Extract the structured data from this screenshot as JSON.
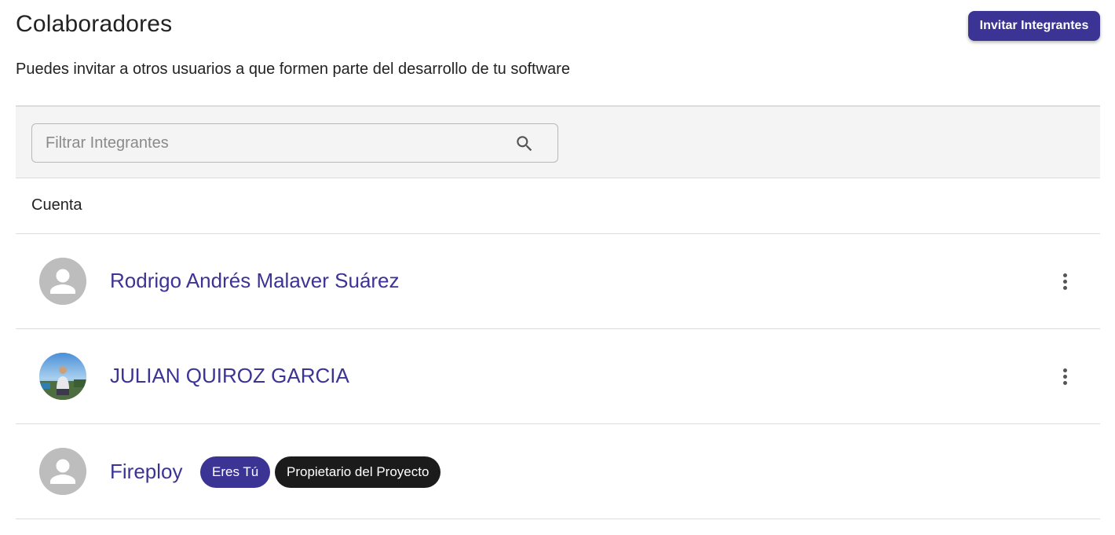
{
  "header": {
    "title": "Colaboradores",
    "invite_label": "Invitar Integrantes",
    "subtitle": "Puedes invitar a otros usuarios a que formen parte del desarrollo de tu software"
  },
  "filter": {
    "placeholder": "Filtrar Integrantes",
    "value": "",
    "icon": "search-icon"
  },
  "table": {
    "column_header": "Cuenta",
    "members": [
      {
        "name": "Rodrigo Andrés Malaver Suárez",
        "avatar": "default-person-icon",
        "has_menu": true
      },
      {
        "name": "JULIAN QUIROZ GARCIA",
        "avatar": "profile-photo",
        "has_menu": true
      },
      {
        "name": "Fireploy",
        "avatar": "default-person-icon",
        "has_menu": false,
        "badges": [
          "Eres Tú",
          "Propietario del Proyecto"
        ]
      }
    ]
  },
  "colors": {
    "accent": "#3c3494",
    "owner_badge": "#1b1b1b",
    "filter_bar_bg": "#f4f4f4",
    "avatar_bg": "#bdbdbd",
    "divider": "#dcdcdc"
  }
}
